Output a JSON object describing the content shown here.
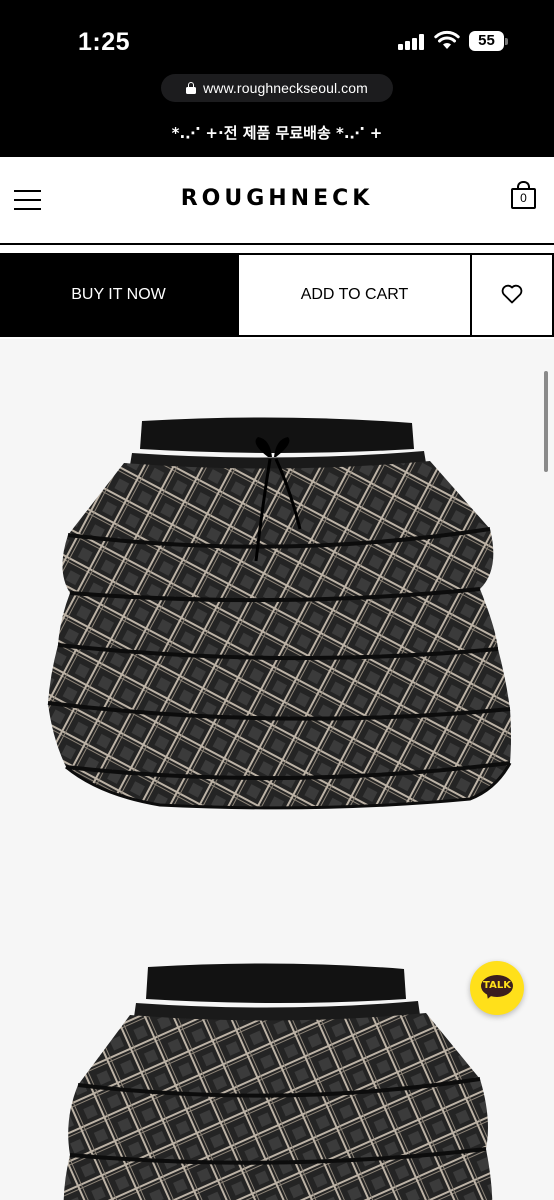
{
  "status_bar": {
    "time": "1:25",
    "battery": "55"
  },
  "browser": {
    "url": "www.roughneckseoul.com"
  },
  "promo_banner": {
    "text": "*.⋰ +·전 제품 무료배송 *.⋰ +"
  },
  "header": {
    "logo": "ROUGHNECK",
    "cart_count": "0"
  },
  "actions": {
    "buy_now_label": "BUY IT NOW",
    "add_to_cart_label": "ADD TO CART"
  },
  "gallery": {
    "images": [
      "tiered plaid ruffle mini skirt - front",
      "tiered plaid ruffle mini skirt - detail"
    ]
  },
  "chat": {
    "label": "TALK"
  },
  "colors": {
    "background": "#ffffff",
    "bar": "#000000",
    "kakao_yellow": "#ffe01a",
    "gallery_bg": "#f6f6f6"
  },
  "icons": [
    "lock-icon",
    "menu-icon",
    "cart-icon",
    "heart-icon",
    "kakao-talk-icon"
  ]
}
